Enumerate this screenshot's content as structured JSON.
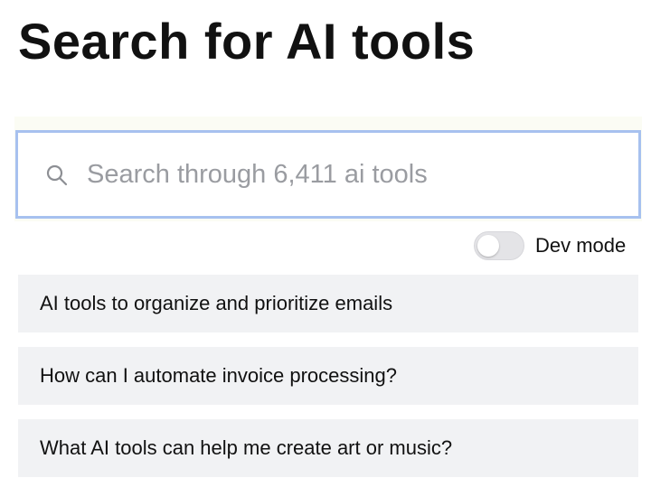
{
  "header": {
    "title": "Search for AI tools"
  },
  "search": {
    "value": "",
    "placeholder": "Search through 6,411 ai tools",
    "icon": "search-icon"
  },
  "dev_mode": {
    "label": "Dev mode",
    "enabled": false
  },
  "suggestions": [
    {
      "label": "AI tools to organize and prioritize emails"
    },
    {
      "label": "How can I automate invoice processing?"
    },
    {
      "label": "What AI tools can help me create art or music?"
    }
  ],
  "colors": {
    "search_border": "#a7c1ef",
    "suggestion_bg": "#f1f2f4",
    "toggle_off": "#e4e4e7",
    "placeholder": "#9a9ca1"
  }
}
